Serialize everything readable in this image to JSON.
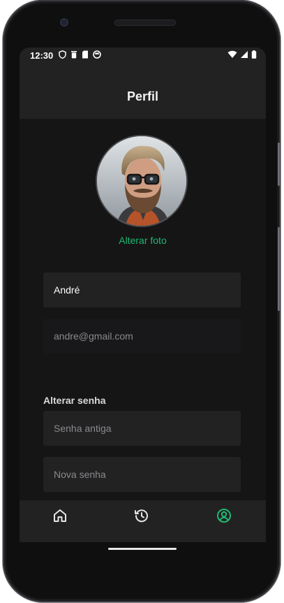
{
  "status_bar": {
    "time": "12:30",
    "left_icons": [
      "shield-icon",
      "trash-icon",
      "sd-card-icon",
      "app-notification-icon"
    ],
    "right_icons": [
      "wifi-icon",
      "cell-signal-icon",
      "battery-icon"
    ]
  },
  "app_bar": {
    "title": "Perfil"
  },
  "profile": {
    "avatar": "profile-photo",
    "change_photo_label": "Alterar foto"
  },
  "form": {
    "name_value": "André",
    "email_value": "andre@gmail.com",
    "password_section_label": "Alterar senha",
    "old_password_placeholder": "Senha antiga",
    "new_password_placeholder": "Nova senha"
  },
  "bottom_nav": {
    "items": [
      {
        "icon": "home-icon",
        "active": false
      },
      {
        "icon": "history-icon",
        "active": false
      },
      {
        "icon": "profile-icon",
        "active": true
      }
    ]
  },
  "colors": {
    "accent": "#1fb872",
    "background": "#151516",
    "surface": "#222223",
    "text_primary": "#ffffff",
    "text_secondary": "#8a8a8e"
  }
}
